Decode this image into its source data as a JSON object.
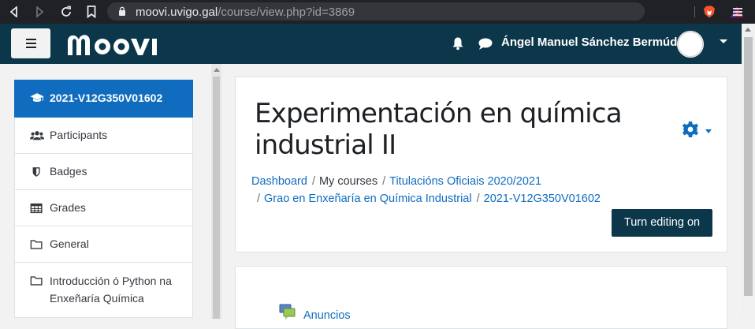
{
  "browser": {
    "url_domain": "moovi.uvigo.gal",
    "url_path": "/course/view.php?id=3869"
  },
  "navbar": {
    "logo_text": "moovi",
    "user_name": "Ángel Manuel Sánchez Bermúdez"
  },
  "drawer": {
    "items": [
      {
        "label": "2021-V12G350V01602",
        "icon": "graduation-cap-icon",
        "active": true
      },
      {
        "label": "Participants",
        "icon": "users-icon"
      },
      {
        "label": "Badges",
        "icon": "shield-icon"
      },
      {
        "label": "Grades",
        "icon": "table-icon"
      },
      {
        "label": "General",
        "icon": "folder-icon"
      },
      {
        "label": "Introducción ó Python na Enxeñaría Química",
        "icon": "folder-icon"
      }
    ]
  },
  "course": {
    "title": "Experimentación en química industrial II",
    "breadcrumb": {
      "dashboard": "Dashboard",
      "my_courses": "My courses",
      "category": "Titulacións Oficiais 2020/2021",
      "degree": "Grao en Enxeñaría en Química Industrial",
      "course_code": "2021-V12G350V01602",
      "separator": "/"
    },
    "edit_button": "Turn editing on"
  },
  "content": {
    "first_activity": "Anuncios"
  },
  "colors": {
    "navbar": "#0c3649",
    "primary": "#0f6cbf"
  }
}
